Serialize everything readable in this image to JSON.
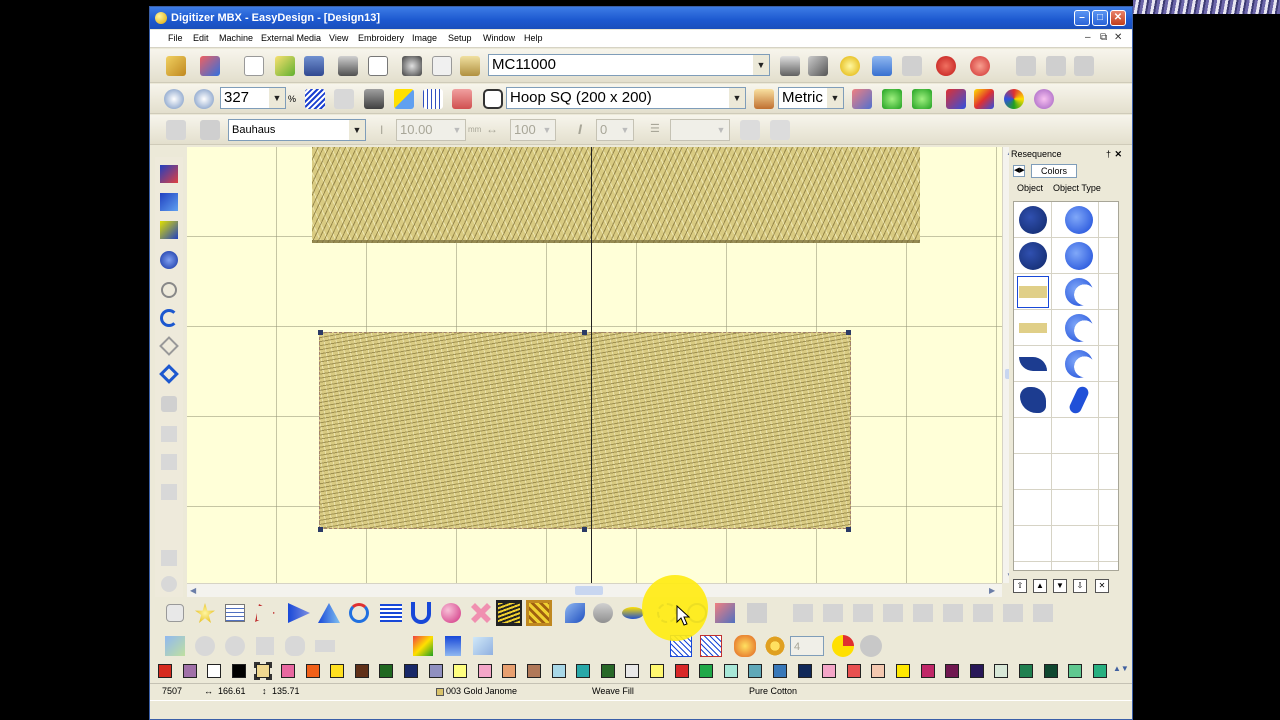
{
  "window": {
    "title": "Digitizer MBX - EasyDesign - [Design13]"
  },
  "menu": [
    "File",
    "Edit",
    "Machine",
    "External Media",
    "View",
    "Embroidery",
    "Image",
    "Setup",
    "Window",
    "Help"
  ],
  "toolbar1": {
    "machine": "MC11000"
  },
  "toolbar2": {
    "zoom": "327",
    "zoom_unit": "%",
    "hoop": "Hoop SQ (200 x 200)",
    "units": "Metric"
  },
  "toolbar3": {
    "font": "Bauhaus",
    "size": "10.00",
    "size_unit": "mm",
    "width": "100",
    "italic": "0"
  },
  "resequence": {
    "title": "Resequence",
    "colors_button": "Colors",
    "tab_object": "Object",
    "tab_object_type": "Object Type"
  },
  "statusbar": {
    "stitches": "7507",
    "width": "166.61",
    "height": "135.71",
    "thread": "003 Gold Janome",
    "fill_type": "Weave Fill",
    "material": "Pure Cotton"
  },
  "spin_value": "4",
  "palette": [
    "#d62a1e",
    "#a070a8",
    "#ffffff",
    "#000000",
    "#f0d890",
    "#e868a0",
    "#f06018",
    "#ffe020",
    "#603018",
    "#206820",
    "#182868",
    "#9090c0",
    "#ffff80",
    "#f4a6c8",
    "#e8a070",
    "#b07858",
    "#a8d8e8",
    "#28a8a8",
    "#286828",
    "#e8e8e8",
    "#fff870",
    "#d82828",
    "#20a848",
    "#a8e8d8",
    "#60a8b8",
    "#3878b8",
    "#102858",
    "#f4a6c8",
    "#e85050",
    "#f4c8b0",
    "#ffe800",
    "#c02868",
    "#701850",
    "#281858",
    "#d8e8d8",
    "#208050",
    "#104830",
    "#60c890",
    "#28b080"
  ],
  "colors": {
    "accent": "#1c58cf",
    "canvas": "#ffffd8",
    "thread": "#d9cb82",
    "highlight": "#ffec14"
  }
}
